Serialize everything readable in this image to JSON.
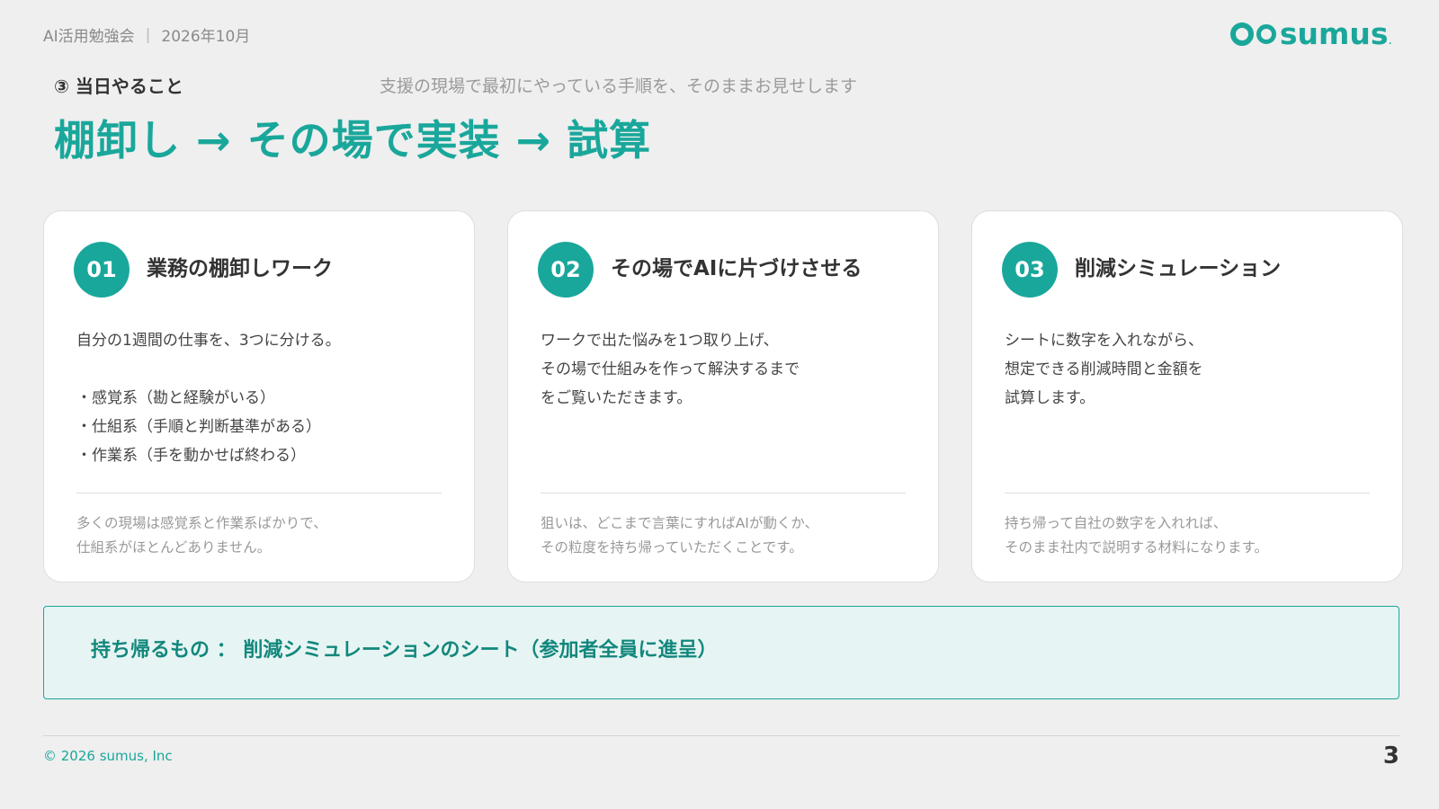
{
  "header": {
    "event": "AI活用勉強会",
    "separator": "|",
    "date": "2026年10月",
    "logo_text": "sumus",
    "logo_dot": "."
  },
  "section": {
    "label": "③ 当日やること",
    "subtitle": "支援の現場で最初にやっている手順を、そのままお見せします",
    "title": "棚卸し → その場で実装 → 試算"
  },
  "cards": [
    {
      "number": "01",
      "title": "業務の棚卸しワーク",
      "body": [
        "自分の1週間の仕事を、3つに分ける。",
        "",
        "・感覚系（勘と経験がいる）",
        "・仕組系（手順と判断基準がある）",
        "・作業系（手を動かせば終わる）"
      ],
      "note": [
        "多くの現場は感覚系と作業系ばかりで、",
        "仕組系がほとんどありません。"
      ]
    },
    {
      "number": "02",
      "title": "その場でAIに片づけさせる",
      "body": [
        "ワークで出た悩みを1つ取り上げ、",
        "その場で仕組みを作って解決するまで",
        "をご覧いただきます。"
      ],
      "note": [
        "狙いは、どこまで言葉にすればAIが動くか、",
        "その粒度を持ち帰っていただくことです。"
      ]
    },
    {
      "number": "03",
      "title": "削減シミュレーション",
      "body": [
        "シートに数字を入れながら、",
        "想定できる削減時間と金額を",
        "試算します。"
      ],
      "note": [
        "持ち帰って自社の数字を入れれば、",
        "そのまま社内で説明する材料になります。"
      ]
    }
  ],
  "takeaway": {
    "text": "持ち帰るもの ： 削減シミュレーションのシート（参加者全員に進呈）"
  },
  "footer": {
    "copyright": "© 2026 sumus, Inc",
    "page": "3"
  },
  "colors": {
    "accent": "#1aa79b",
    "background": "#efefef",
    "takeaway_bg": "#e6f5f3"
  }
}
